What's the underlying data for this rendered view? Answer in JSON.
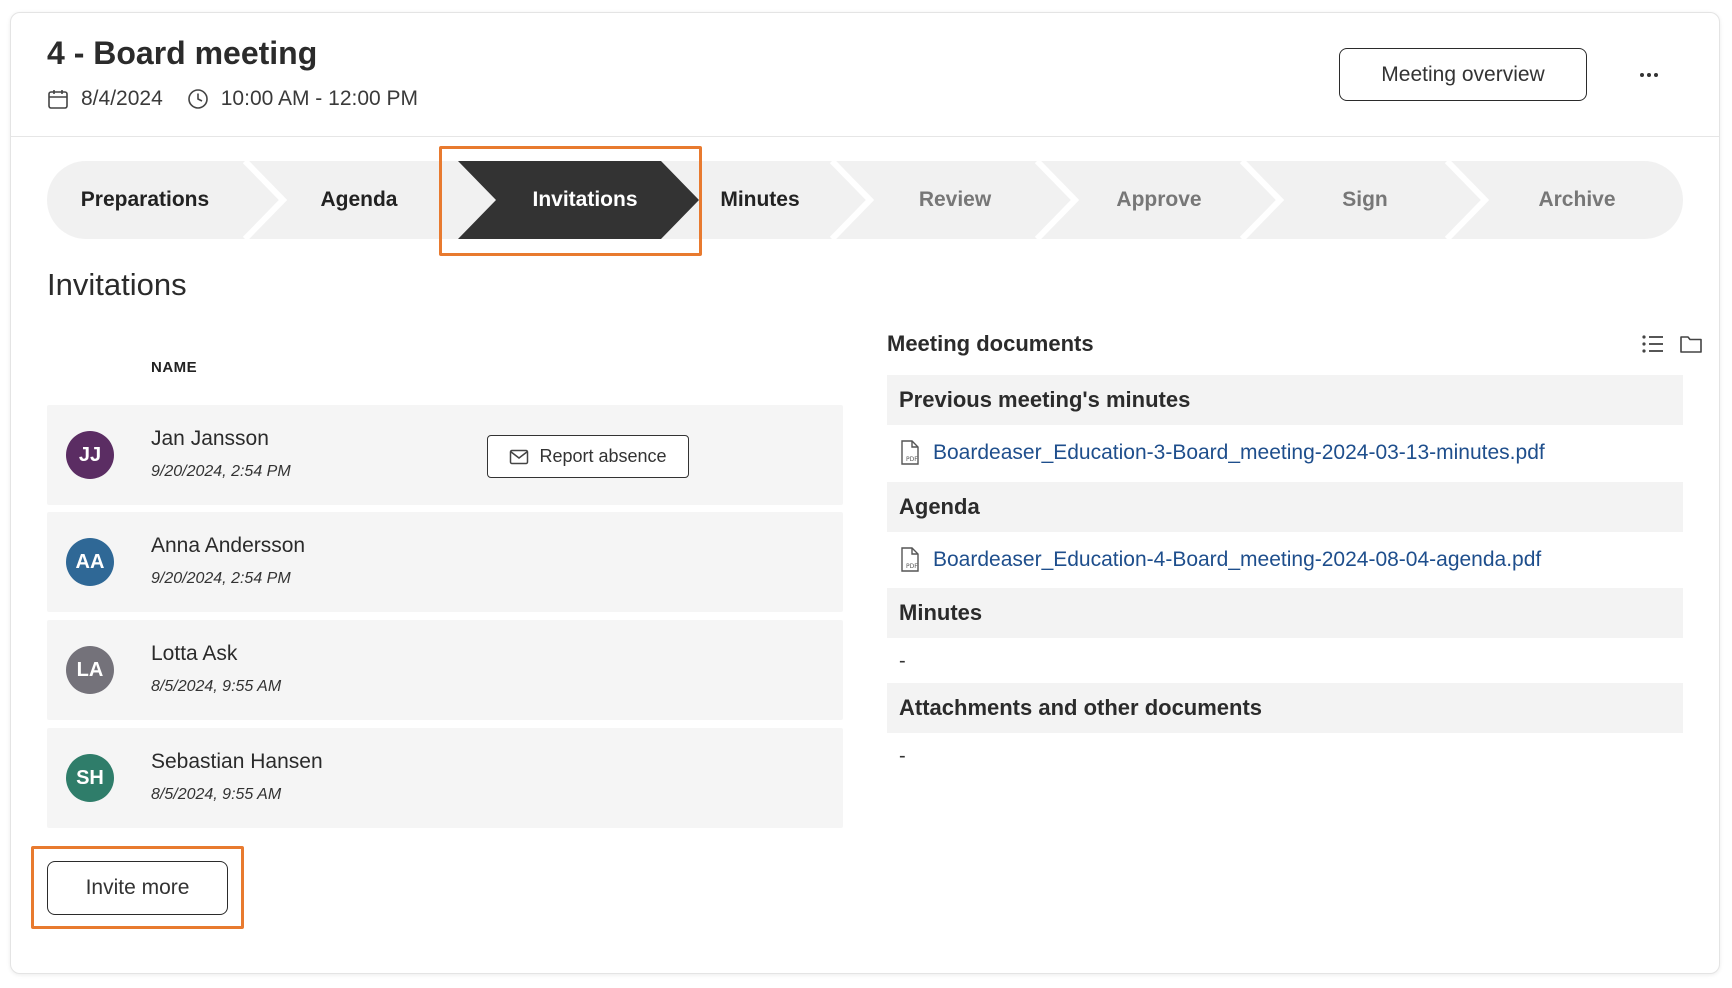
{
  "meeting": {
    "title": "4 - Board meeting",
    "date": "8/4/2024",
    "time": "10:00 AM - 12:00 PM",
    "overview_label": "Meeting overview",
    "more_icon": "ellipsis-icon"
  },
  "steps": [
    {
      "label": "Preparations",
      "state": "done"
    },
    {
      "label": "Agenda",
      "state": "done"
    },
    {
      "label": "Invitations",
      "state": "active"
    },
    {
      "label": "Minutes",
      "state": "done"
    },
    {
      "label": "Review",
      "state": "future"
    },
    {
      "label": "Approve",
      "state": "future"
    },
    {
      "label": "Sign",
      "state": "future"
    },
    {
      "label": "Archive",
      "state": "future"
    }
  ],
  "invitations": {
    "title": "Invitations",
    "column_name": "NAME",
    "report_absence_label": "Report absence",
    "invite_more_label": "Invite more",
    "people": [
      {
        "initials": "JJ",
        "name": "Jan Jansson",
        "date": "9/20/2024, 2:54 PM",
        "color": "#5b2d63"
      },
      {
        "initials": "AA",
        "name": "Anna Andersson",
        "date": "9/20/2024, 2:54 PM",
        "color": "#2f6896"
      },
      {
        "initials": "LA",
        "name": "Lotta Ask",
        "date": "8/5/2024, 9:55 AM",
        "color": "#74727a"
      },
      {
        "initials": "SH",
        "name": "Sebastian Hansen",
        "date": "8/5/2024, 9:55 AM",
        "color": "#2f7d6a"
      }
    ]
  },
  "documents": {
    "title": "Meeting documents",
    "groups": [
      {
        "title": "Previous meeting's minutes",
        "file": "Boardeaser_Education-3-Board_meeting-2024-03-13-minutes.pdf"
      },
      {
        "title": "Agenda",
        "file": "Boardeaser_Education-4-Board_meeting-2024-08-04-agenda.pdf"
      },
      {
        "title": "Minutes",
        "empty": "-"
      },
      {
        "title": "Attachments and other documents",
        "empty": "-"
      }
    ]
  },
  "colors": {
    "active_step": "#333333",
    "step_bg": "#f1f1f1",
    "highlight": "#e87a2f",
    "link": "#1e4e8c"
  }
}
